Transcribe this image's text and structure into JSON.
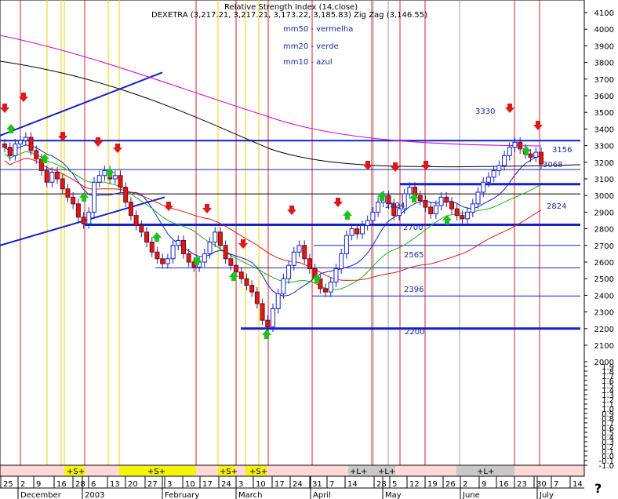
{
  "header": {
    "top_label": "Relative Strength Index (14,close)",
    "title_line": "DEXETRA (3,217.21, 3,217.21, 3,173.22, 3,185.83) Zig Zag (3,146.55)",
    "legend_mm50": "mm50 - vermelha",
    "legend_mm20": "mm20 - verde",
    "legend_mm10": "mm10 - azul"
  },
  "corner_glyph": "?",
  "chart_data": {
    "type": "candlestick",
    "ylim": [
      -1.3,
      4150
    ],
    "y_ticks": [
      "4100",
      "4000",
      "3900",
      "3800",
      "3700",
      "3600",
      "3500",
      "3400",
      "3300",
      "3200",
      "3100",
      "3000",
      "2900",
      "2800",
      "2700",
      "2600",
      "2500",
      "2400",
      "2300",
      "2200",
      "2100",
      "2000",
      "1.9",
      "1.8",
      "1.7",
      "1.6",
      "1.5",
      "1.4",
      "1.3",
      "1.2",
      "1.1",
      "1.0",
      "0.9",
      "0.8",
      "0.7",
      "0.6",
      "0.5",
      "0.4",
      "0.3",
      "0.2",
      "0.1",
      "0.0",
      "-0.1",
      "-1.0"
    ],
    "x_ticks": [
      "25",
      "2",
      "9",
      "16",
      "28",
      "6",
      "13",
      "20",
      "27",
      "3",
      "10",
      "17",
      "24",
      "3",
      "10",
      "17",
      "24",
      "31",
      "7",
      "14",
      "28",
      "5",
      "12",
      "19",
      "26",
      "2",
      "9",
      "16",
      "23",
      "30",
      "7",
      "14"
    ],
    "months": [
      "December",
      "2003",
      "February",
      "March",
      "April",
      "May",
      "June",
      "July"
    ],
    "levels": [
      {
        "label": "3330",
        "value": 3330
      },
      {
        "label": "3156",
        "value": 3156
      },
      {
        "label": "3068",
        "value": 3068
      },
      {
        "label": "2824",
        "value": 2824
      },
      {
        "label": "2824",
        "value": 2824
      },
      {
        "label": "2700",
        "value": 2700
      },
      {
        "label": "2565",
        "value": 2565
      },
      {
        "label": "2396",
        "value": 2396
      },
      {
        "label": "2200",
        "value": 2200
      }
    ],
    "bottom_markers": [
      "+S+",
      "+S+",
      "+S+",
      "+S+",
      "+L+",
      "+L+",
      "+L+"
    ],
    "close": [
      3290,
      3240,
      3310,
      3330,
      3350,
      3270,
      3220,
      3150,
      3080,
      3140,
      3100,
      3040,
      2990,
      2950,
      2870,
      2830,
      2900,
      3080,
      3120,
      3150,
      3100,
      3120,
      3050,
      2960,
      2880,
      2820,
      2780,
      2720,
      2660,
      2620,
      2590,
      2620,
      2700,
      2730,
      2650,
      2600,
      2570,
      2600,
      2650,
      2720,
      2780,
      2700,
      2620,
      2580,
      2540,
      2500,
      2460,
      2420,
      2350,
      2250,
      2210,
      2320,
      2410,
      2500,
      2580,
      2660,
      2700,
      2620,
      2560,
      2500,
      2440,
      2420,
      2480,
      2560,
      2650,
      2760,
      2800,
      2770,
      2820,
      2850,
      2900,
      2960,
      3000,
      2950,
      2880,
      2920,
      3010,
      3050,
      3000,
      2970,
      2930,
      2890,
      2940,
      2990,
      2960,
      2920,
      2880,
      2860,
      2900,
      2950,
      3020,
      3080,
      3110,
      3150,
      3180,
      3240,
      3290,
      3320,
      3280,
      3250,
      3230,
      3260,
      3190
    ]
  }
}
